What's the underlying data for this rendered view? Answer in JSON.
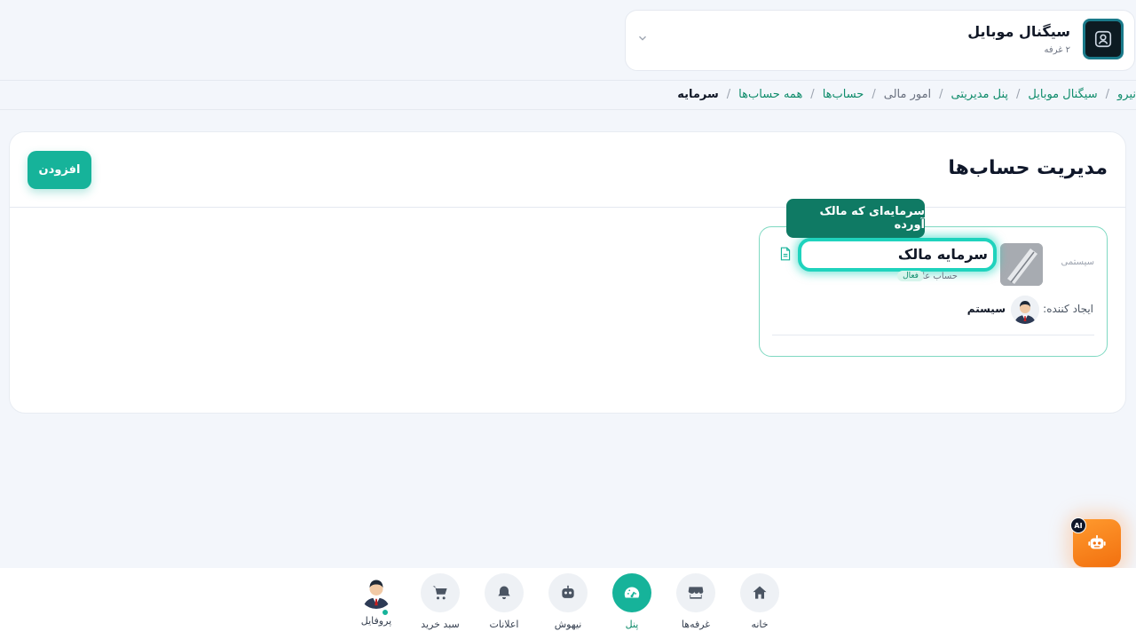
{
  "shop": {
    "name": "سیگنال موبایل",
    "subtitle": "۲ غرفه"
  },
  "breadcrumb": [
    {
      "label": "نیرو",
      "style": "link"
    },
    {
      "label": "سیگنال موبایل",
      "style": "link"
    },
    {
      "label": "پنل مدیریتی",
      "style": "link"
    },
    {
      "label": "امور مالی",
      "style": "plain"
    },
    {
      "label": "حساب‌ها",
      "style": "link"
    },
    {
      "label": "همه حساب‌ها",
      "style": "link"
    },
    {
      "label": "سرمایه",
      "style": "current"
    }
  ],
  "breadcrumb_separator": "/",
  "page": {
    "title": "مدیریت حساب‌ها",
    "add_button": "افزودن"
  },
  "account": {
    "system_label": "سیستمی",
    "name": "سرمایه مالک",
    "type": "حساب عادی",
    "status": "فعال",
    "creator_label": "ایجاد کننده:",
    "creator_name": "سیستم"
  },
  "tooltip": "سرمایه‌ای که مالک آورده",
  "ai": {
    "badge": "AI"
  },
  "nav": {
    "home": "خانه",
    "booths": "غرفه‌ها",
    "panel": "پنل",
    "assistant": "نیهوش",
    "notifications": "اعلانات",
    "cart": "سبد خرید",
    "profile": "پروفایل"
  },
  "colors": {
    "accent": "#16b39a",
    "accent_dark": "#0f7a64",
    "link": "#0f8c6b",
    "ai_orange": "#f2700f"
  }
}
